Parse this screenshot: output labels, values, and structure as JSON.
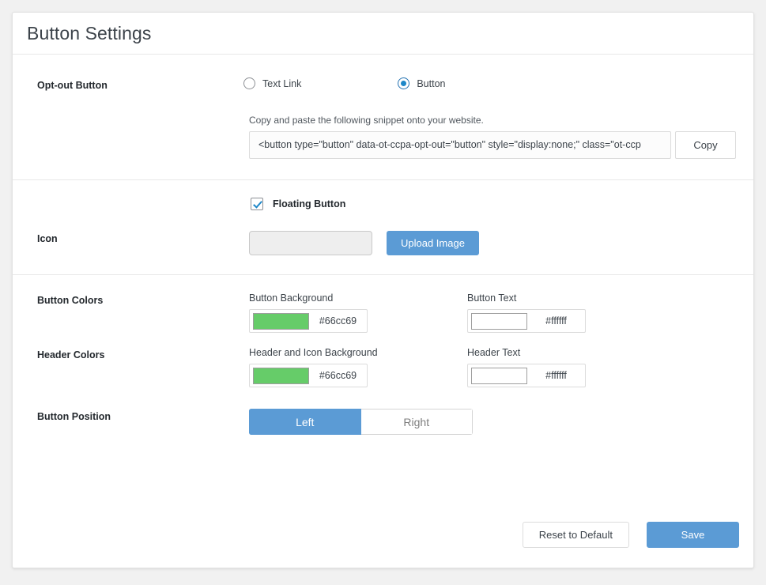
{
  "page": {
    "title": "Button Settings"
  },
  "optout": {
    "label": "Opt-out Button",
    "options": [
      {
        "label": "Text Link",
        "selected": false
      },
      {
        "label": "Button",
        "selected": true
      }
    ],
    "snippet_help": "Copy and paste the following snippet onto your website.",
    "snippet_value": "<button type=\"button\" data-ot-ccpa-opt-out=\"button\" style=\"display:none;\" class=\"ot-ccp",
    "copy_label": "Copy"
  },
  "floating": {
    "checkbox_label": "Floating Button",
    "checked": true
  },
  "icon": {
    "label": "Icon",
    "input_value": "",
    "input_placeholder": "",
    "upload_label": "Upload Image"
  },
  "button_colors": {
    "label": "Button Colors",
    "background": {
      "caption": "Button Background",
      "hex": "#66cc69"
    },
    "text": {
      "caption": "Button Text",
      "hex": "#ffffff"
    }
  },
  "header_colors": {
    "label": "Header Colors",
    "background": {
      "caption": "Header and Icon Background",
      "hex": "#66cc69"
    },
    "text": {
      "caption": "Header Text",
      "hex": "#ffffff"
    }
  },
  "button_position": {
    "label": "Button Position",
    "options": [
      {
        "label": "Left",
        "selected": true
      },
      {
        "label": "Right",
        "selected": false
      }
    ]
  },
  "footer": {
    "reset_label": "Reset to Default",
    "save_label": "Save"
  },
  "theme": {
    "accent_blue": "#5b9bd5",
    "radio_blue": "#1e87c8",
    "green": "#66cc69",
    "white": "#ffffff",
    "page_bg": "#f1f1f1"
  }
}
